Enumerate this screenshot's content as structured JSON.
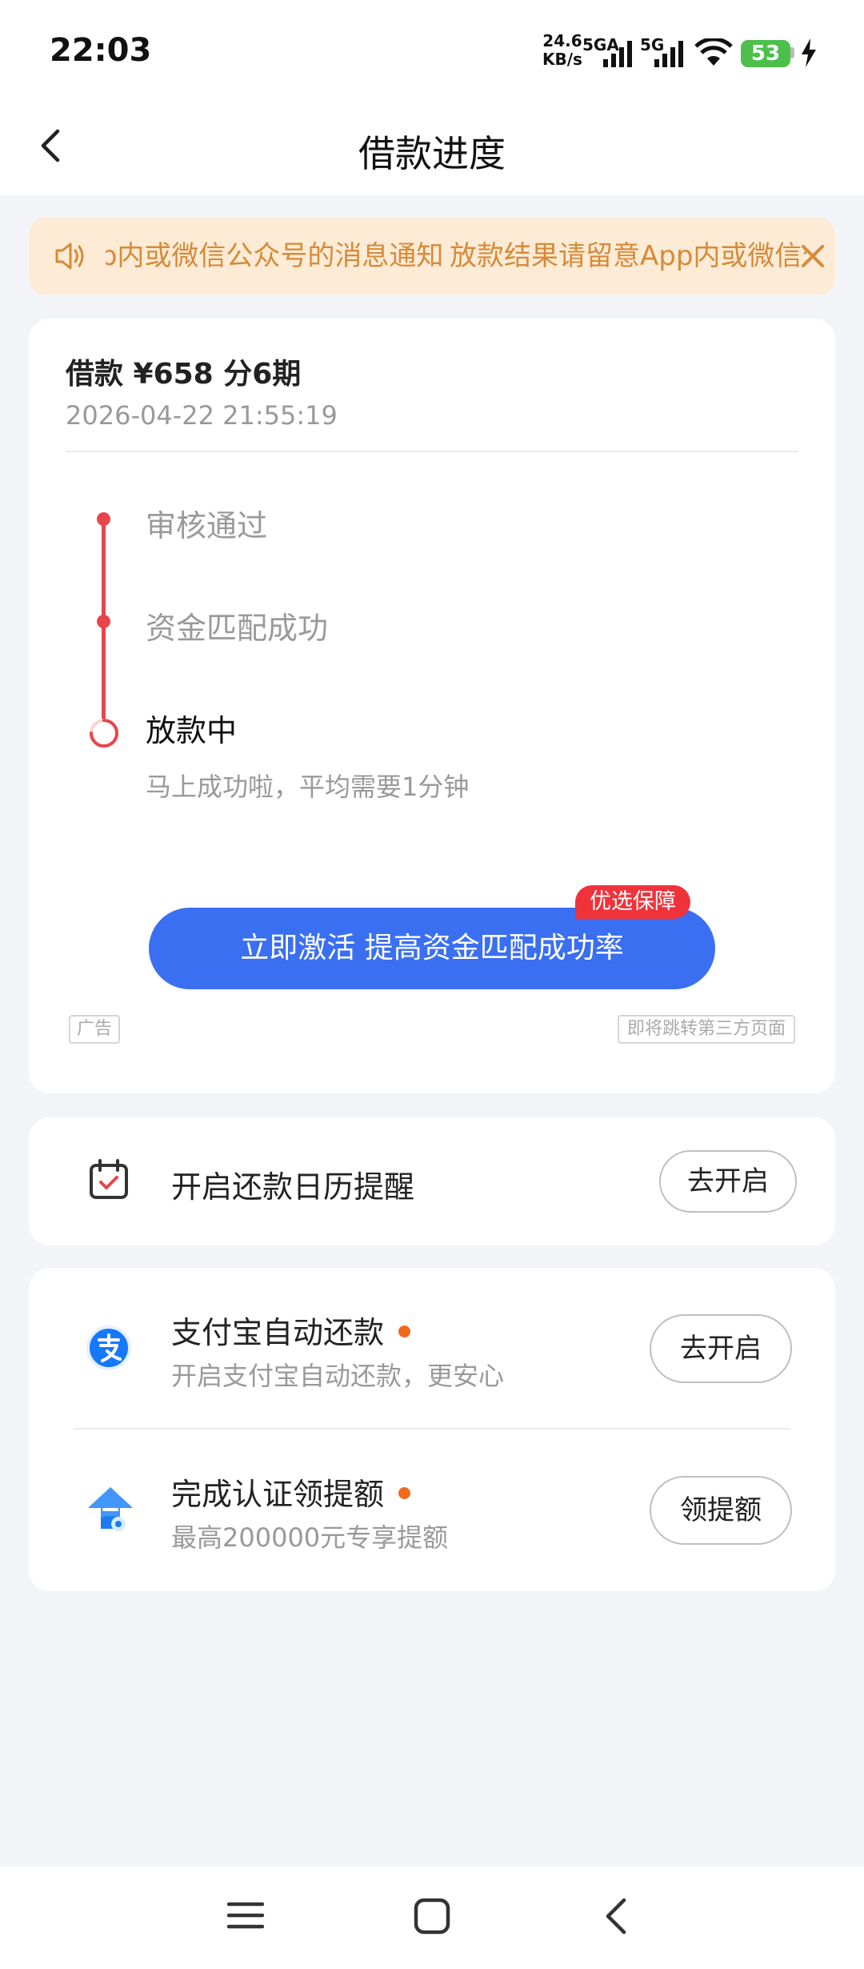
{
  "status_bar": {
    "time": "22:03",
    "speed_value": "24.6",
    "speed_unit": "KB/s",
    "net1": "5GA",
    "net2": "5G",
    "battery": "53"
  },
  "nav": {
    "title": "借款进度"
  },
  "notice": {
    "text": "放款结果请留意App内或微信公众号的消息通知"
  },
  "loan": {
    "amount_line": "借款 ¥658  分6期",
    "time": "2026-04-22 21:55:19",
    "steps": [
      {
        "label": "审核通过"
      },
      {
        "label": "资金匹配成功"
      },
      {
        "label": "放款中",
        "sub": "马上成功啦，平均需要1分钟"
      }
    ],
    "cta_label": "立即激活 提高资金匹配成功率",
    "cta_badge": "优选保障",
    "ad_tag": "广告",
    "third_party_tag": "即将跳转第三方页面"
  },
  "calendar": {
    "label": "开启还款日历提醒",
    "button": "去开启"
  },
  "services": [
    {
      "title": "支付宝自动还款",
      "sub": "开启支付宝自动还款，更安心",
      "button": "去开启",
      "icon": "alipay-icon"
    },
    {
      "title": "完成认证领提额",
      "sub": "最高200000元专享提额",
      "button": "领提额",
      "icon": "limit-up-icon"
    }
  ],
  "colors": {
    "primary": "#3a6ff2",
    "timeline_red": "#e8454b",
    "notice_bg": "#fdebd5",
    "notice_text": "#d78a39",
    "dot_orange": "#f06a1c"
  }
}
